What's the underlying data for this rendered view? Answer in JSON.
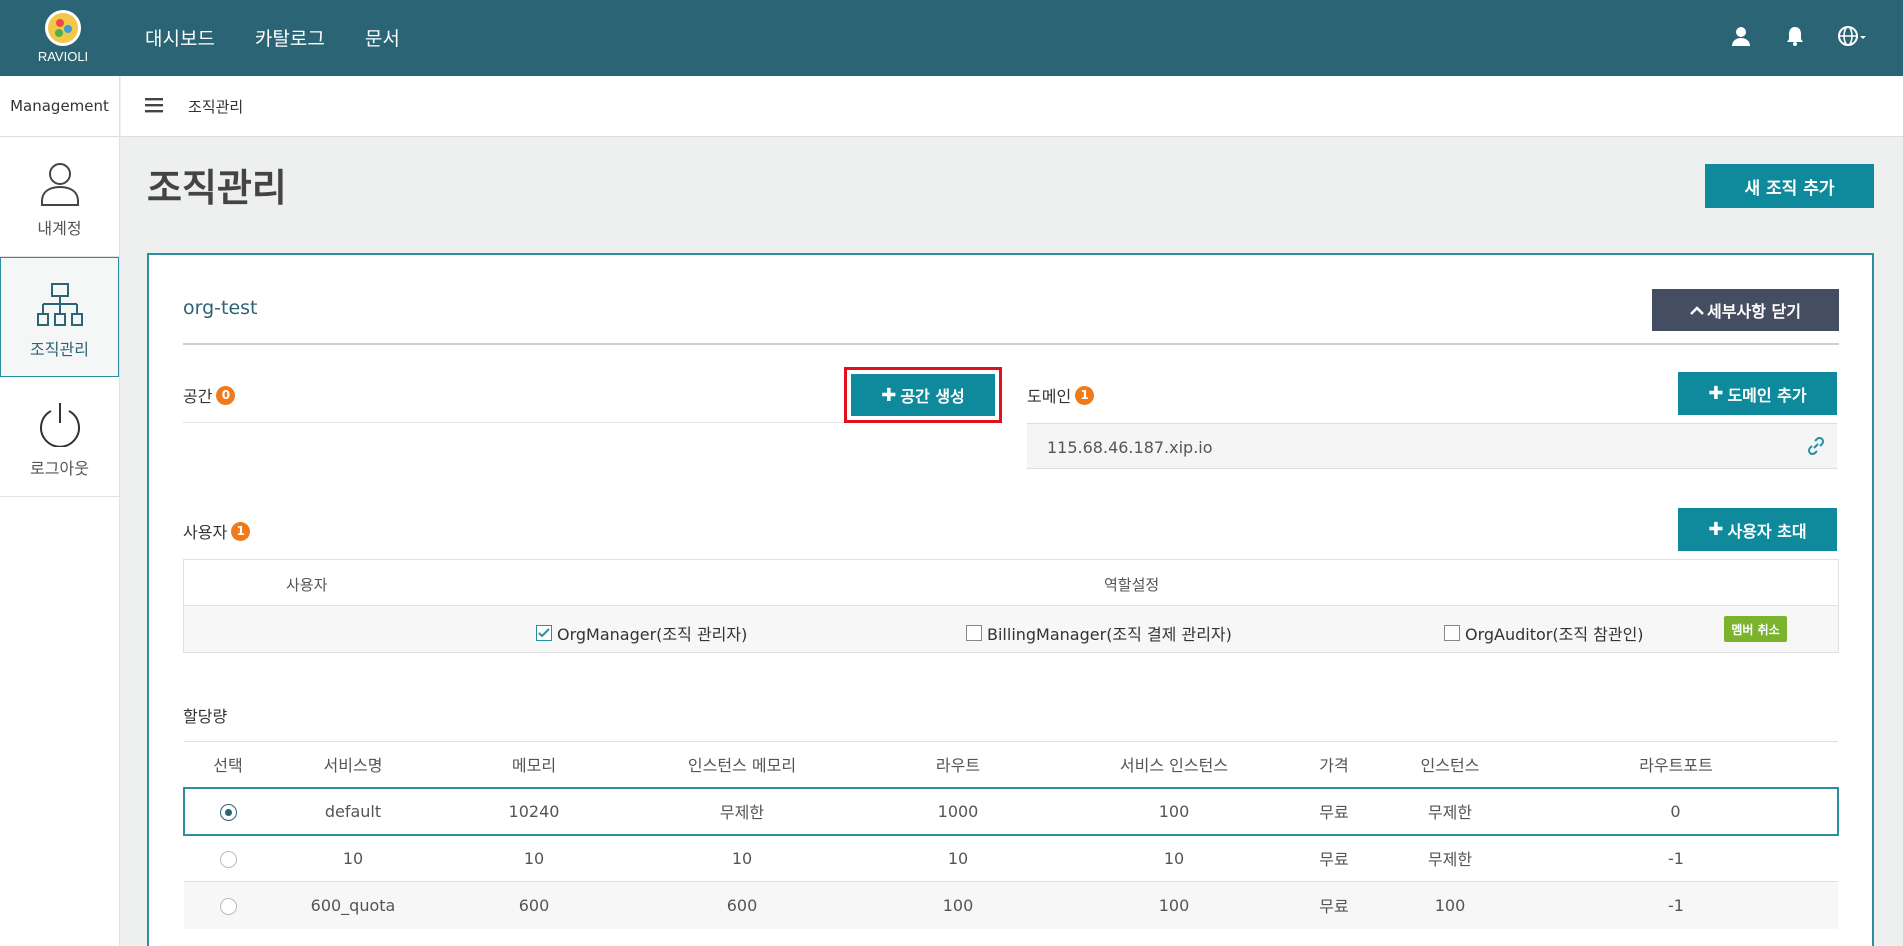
{
  "brand": {
    "logo_text": "RAVIOLI"
  },
  "topnav": {
    "items": [
      "대시보드",
      "카탈로그",
      "문서"
    ]
  },
  "topicons": [
    "user-icon",
    "bell-icon",
    "globe-icon"
  ],
  "sidebar": {
    "header": "Management",
    "items": [
      {
        "label": "내계정",
        "icon": "user-icon"
      },
      {
        "label": "조직관리",
        "icon": "org-chart-icon"
      },
      {
        "label": "로그아웃",
        "icon": "power-icon"
      }
    ]
  },
  "breadcrumb": {
    "current": "조직관리"
  },
  "page": {
    "title": "조직관리",
    "add_org_label": "새 조직 추가"
  },
  "org": {
    "name": "org-test",
    "close_detail_label": "세부사항 닫기",
    "space": {
      "label": "공간",
      "count": "0",
      "create_label": "공간 생성"
    },
    "domain": {
      "label": "도메인",
      "count": "1",
      "add_label": "도메인 추가",
      "value": "115.68.46.187.xip.io"
    },
    "users": {
      "label": "사용자",
      "count": "1",
      "invite_label": "사용자 초대",
      "col_user": "사용자",
      "col_role": "역할설정",
      "roles": [
        {
          "label": "OrgManager(조직 관리자)",
          "checked": true
        },
        {
          "label": "BillingManager(조직 결제 관리자)",
          "checked": false
        },
        {
          "label": "OrgAuditor(조직 참관인)",
          "checked": false
        }
      ],
      "cancel_member_label": "멤버 취소"
    },
    "quota": {
      "label": "할당량",
      "columns": [
        "선택",
        "서비스명",
        "메모리",
        "인스턴스 메모리",
        "라우트",
        "서비스 인스턴스",
        "가격",
        "인스턴스",
        "라우트포트"
      ],
      "rows": [
        [
          "default",
          "10240",
          "무제한",
          "1000",
          "100",
          "무료",
          "무제한",
          "0"
        ],
        [
          "10",
          "10",
          "10",
          "10",
          "10",
          "무료",
          "무제한",
          "-1"
        ],
        [
          "600_quota",
          "600",
          "600",
          "100",
          "100",
          "무료",
          "100",
          "-1"
        ]
      ],
      "selected_row": 0
    }
  },
  "colors": {
    "navbar": "#2b6474",
    "accent": "#0f8a9d",
    "badge": "#f07a1a",
    "highlight": "#e0111d",
    "cancel": "#7bb32e"
  }
}
